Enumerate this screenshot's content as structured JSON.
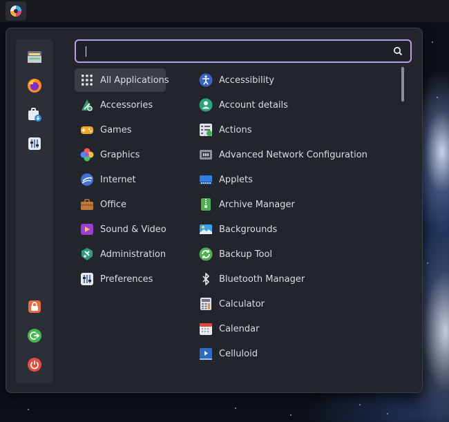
{
  "search": {
    "value": "",
    "placeholder": ""
  },
  "favorites": [
    {
      "name": "files"
    },
    {
      "name": "firefox"
    },
    {
      "name": "software-manager"
    },
    {
      "name": "settings"
    }
  ],
  "session": [
    {
      "name": "lock-screen"
    },
    {
      "name": "logout"
    },
    {
      "name": "shutdown"
    }
  ],
  "categories": [
    {
      "label": "All Applications",
      "icon": "grid-icon"
    },
    {
      "label": "Accessories",
      "icon": "accessories-icon"
    },
    {
      "label": "Games",
      "icon": "gamepad-icon"
    },
    {
      "label": "Graphics",
      "icon": "graphics-icon"
    },
    {
      "label": "Internet",
      "icon": "internet-icon"
    },
    {
      "label": "Office",
      "icon": "briefcase-icon"
    },
    {
      "label": "Sound & Video",
      "icon": "sound-video-icon"
    },
    {
      "label": "Administration",
      "icon": "administration-icon"
    },
    {
      "label": "Preferences",
      "icon": "preferences-icon"
    }
  ],
  "apps": [
    {
      "label": "Accessibility",
      "icon": "accessibility-icon"
    },
    {
      "label": "Account details",
      "icon": "account-icon"
    },
    {
      "label": "Actions",
      "icon": "actions-icon"
    },
    {
      "label": "Advanced Network Configuration",
      "icon": "network-icon"
    },
    {
      "label": "Applets",
      "icon": "applets-icon"
    },
    {
      "label": "Archive Manager",
      "icon": "archive-icon"
    },
    {
      "label": "Backgrounds",
      "icon": "backgrounds-icon"
    },
    {
      "label": "Backup Tool",
      "icon": "backup-icon"
    },
    {
      "label": "Bluetooth Manager",
      "icon": "bluetooth-icon"
    },
    {
      "label": "Calculator",
      "icon": "calculator-icon"
    },
    {
      "label": "Calendar",
      "icon": "calendar-icon"
    },
    {
      "label": "Celluloid",
      "icon": "celluloid-icon"
    }
  ],
  "colors": {
    "accent": "#b99ee3",
    "panel": "#23252d",
    "text": "#dcdde2"
  }
}
